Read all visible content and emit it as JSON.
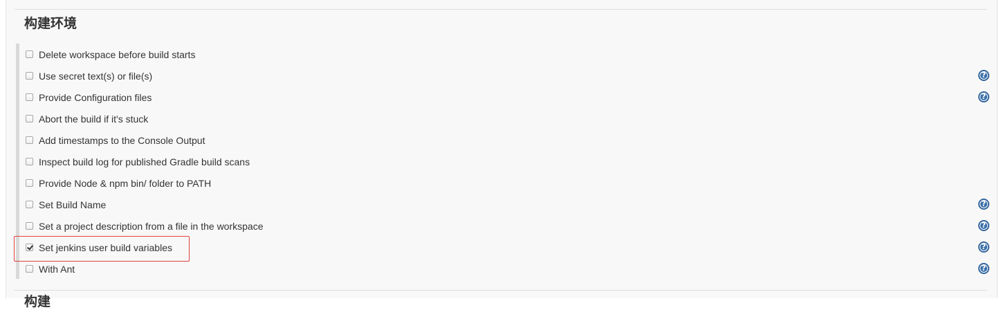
{
  "section": {
    "title": "构建环境",
    "next_title": "构建"
  },
  "options": [
    {
      "label": "Delete workspace before build starts",
      "checked": false,
      "help": false
    },
    {
      "label": "Use secret text(s) or file(s)",
      "checked": false,
      "help": true
    },
    {
      "label": "Provide Configuration files",
      "checked": false,
      "help": true
    },
    {
      "label": "Abort the build if it's stuck",
      "checked": false,
      "help": false
    },
    {
      "label": "Add timestamps to the Console Output",
      "checked": false,
      "help": false
    },
    {
      "label": "Inspect build log for published Gradle build scans",
      "checked": false,
      "help": false
    },
    {
      "label": "Provide Node & npm bin/ folder to PATH",
      "checked": false,
      "help": false
    },
    {
      "label": "Set Build Name",
      "checked": false,
      "help": true
    },
    {
      "label": "Set a project description from a file in the workspace",
      "checked": false,
      "help": true
    },
    {
      "label": "Set jenkins user build variables",
      "checked": true,
      "help": true,
      "highlighted": true
    },
    {
      "label": "With Ant",
      "checked": false,
      "help": true
    }
  ],
  "help_icon": {
    "glyph": "?",
    "icon": "question-circle-icon",
    "color": "#3b6fa8"
  },
  "highlight_color": "#e0413c"
}
